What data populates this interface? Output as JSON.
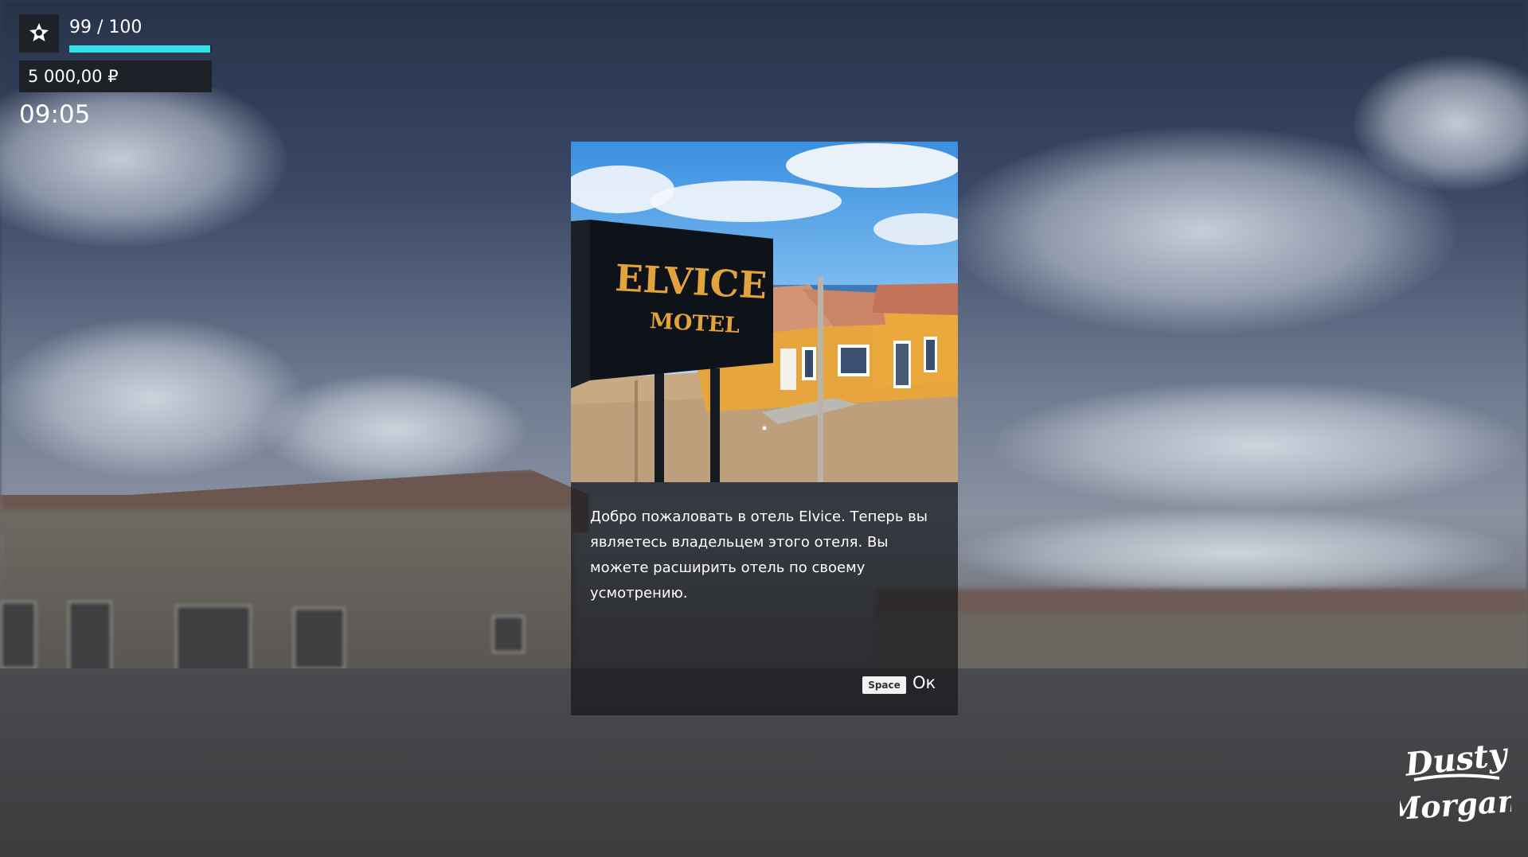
{
  "hud": {
    "rating_text": "99 / 100",
    "rating_fraction": 0.99,
    "money": "5 000,00 ₽",
    "time": "09:05",
    "rating_icon": "star-badge-icon",
    "accent_color": "#2fe0e6"
  },
  "dialog": {
    "image": {
      "sign_line1": "ELVICE",
      "sign_line2": "MOTEL"
    },
    "message": "Добро пожаловать в отель Elvice. Теперь вы являетесь владельцем этого отеля. Вы можете расширить отель по своему усмотрению.",
    "key_hint": "Space",
    "ok_label": "Ок"
  },
  "branding": {
    "logo_line1": "Dusty",
    "logo_line2": "Morgan"
  }
}
